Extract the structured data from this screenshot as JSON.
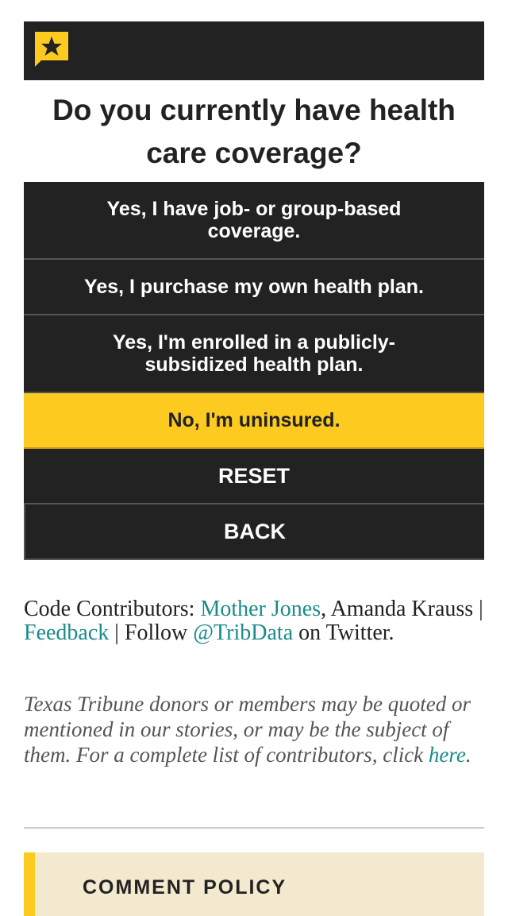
{
  "question": "Do you currently have health care coverage?",
  "options": [
    {
      "label": "Yes, I have job- or group-based coverage.",
      "selected": false
    },
    {
      "label": "Yes, I purchase my own health plan.",
      "selected": false
    },
    {
      "label": "Yes, I'm enrolled in a publicly-subsidized health plan.",
      "selected": false
    },
    {
      "label": "No, I'm uninsured.",
      "selected": true
    }
  ],
  "controls": {
    "reset": "RESET",
    "back": "BACK"
  },
  "credits": {
    "prefix": "Code Contributors: ",
    "link1": "Mother Jones",
    "mid1": ", Amanda Krauss | ",
    "link2": "Feedback",
    "mid2": " | Follow ",
    "link3": "@TribData",
    "suffix": " on Twitter."
  },
  "disclaimer": {
    "text": "Texas Tribune donors or members may be quoted or mentioned in our stories, or may be the subject of them. For a complete list of contributors, click ",
    "link": "here",
    "end": "."
  },
  "comment_policy": {
    "title": "COMMENT POLICY"
  },
  "colors": {
    "dark": "#222222",
    "accent": "#fdca20",
    "link": "#1a8a8a"
  },
  "icons": {
    "logo": "star-flag-icon"
  }
}
